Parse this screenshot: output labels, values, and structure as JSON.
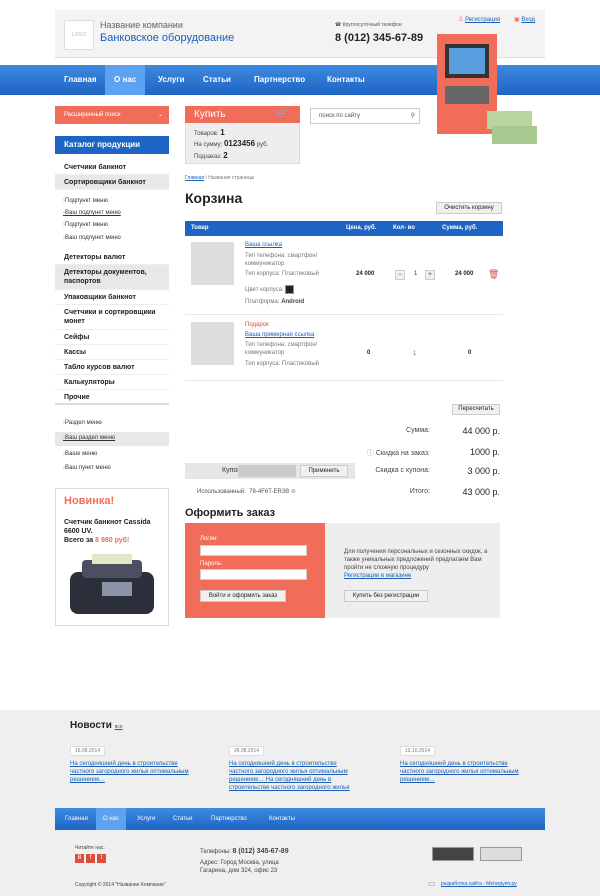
{
  "header": {
    "logo": "LOGO",
    "company": "Название компании",
    "bank": "Банковское оборудование",
    "phone_label": "Круглосуточный телефон:",
    "phone": "8 (012) 345-67-89",
    "register": "Регистрация",
    "login": "Вход"
  },
  "nav": [
    "Главная",
    "О нас",
    "Услуги",
    "Статьи",
    "Партнерство",
    "Контакты"
  ],
  "advanced_search": "Расширенный поиск",
  "cart": {
    "buy": "Купить",
    "goods_label": "Товаров:",
    "goods": "1",
    "sum_label": "На сумму:",
    "sum": "0123456",
    "sum_unit": "руб.",
    "order_label": "Подзаказ:",
    "order": "2"
  },
  "search_placeholder": "поиск по сайту",
  "catalog": {
    "title": "Каталог продукции",
    "items": [
      "Счетчики банкнот",
      "Сортировщики банкнот"
    ],
    "subs": [
      "Подпункт меню",
      "Ваш подпункт меню",
      "Подпункт меню",
      "Ваш подпункт меню"
    ],
    "items2": [
      "Детекторы валют",
      "Детекторы документов, паспортов",
      "Упаковщики банкнот",
      "Счетчики и сортировщики монет",
      "Сейфы",
      "Кассы",
      "Табло курсов валют",
      "Калькуляторы",
      "Прочие"
    ]
  },
  "side_menu": [
    "Раздел меню",
    "Ваш раздел меню",
    "Ваше меню",
    "Ваш пункт меню"
  ],
  "promo": {
    "title": "Новинка!",
    "desc": "Счетчик банкнот Cassida 6600 UV.",
    "price_label": "Всего за",
    "price": "8 980 руб!"
  },
  "breadcrumb": {
    "home": "Главная",
    "sep": "\\",
    "page": "Название страницы"
  },
  "page_title": "Корзина",
  "clear_cart": "Очистить корзину",
  "table": {
    "headers": [
      "Товар",
      "Цена, руб.",
      "Кол- во",
      "Сумма, руб."
    ],
    "row1": {
      "link": "Ваша ссылка",
      "phone": "Тип телефона: смартфон/ коммуникатор",
      "body": "Тип корпуса: Пластиковый",
      "color": "Цвет корпуса:",
      "platform": "Платформа:",
      "platform_val": "Android",
      "price": "24 000",
      "qty": "1",
      "sum": "24 000"
    },
    "row2": {
      "gift": "Подарок",
      "link": "Ваша примерная ссылка",
      "phone": "Тип телефона: смартфон/ коммуникатор",
      "body": "Тип корпуса: Пластиковый",
      "price": "0",
      "qty": "1",
      "sum": "0"
    }
  },
  "recalc": "Пересчитать",
  "totals": [
    {
      "label": "Сумма:",
      "value": "44 000 р."
    },
    {
      "label": "Скидка на заказ:",
      "value": "1000 р."
    },
    {
      "label": "Скидка с купона:",
      "value": "3 000 р."
    },
    {
      "label": "Итого:",
      "value": "43 000 р."
    }
  ],
  "coupon": {
    "label": "Купон:",
    "apply": "Применить",
    "used_label": "Использованный:",
    "used": "78-4F6T-ER3B"
  },
  "order": {
    "title": "Оформить заказ",
    "login": "Логин:",
    "password": "Пароль:",
    "submit": "Войти и оформить заказ",
    "info": "Для получения персональных и сезонных скидок, а также уникальных предложений предлагаем Вам пройти не сложную процедуру",
    "reg_link": "Регистрации в магазине",
    "buy_noreg": "Купить без регистрации"
  },
  "news": {
    "title": "Новости",
    "all": "все",
    "items": [
      {
        "date": "16.08.2014",
        "text": "На сегодняшний день в строительстве частного загородного жилья оптимальным решением…"
      },
      {
        "date": "26.08.2014",
        "text": "На сегодняшний день в строительстве частного загородного жилья оптимальным решением… На сегодняшний день в строительстве частного загородного жилья"
      },
      {
        "date": "12.10.2014",
        "text": "На сегодняшний день в строительстве частного загородного жилья оптимальным решением…"
      }
    ]
  },
  "footer": {
    "read_us": "Читайте нас:",
    "phones_label": "Телефоны:",
    "phones": "8 (012) 345-67-89",
    "address": "Адрес: Город Москва, улица Гагарина, дом 324, офис 23",
    "copyright": "Copyright © 2014 \"Название Компании\"",
    "dev": "разработка сайта - Мегагрупп.ру"
  }
}
